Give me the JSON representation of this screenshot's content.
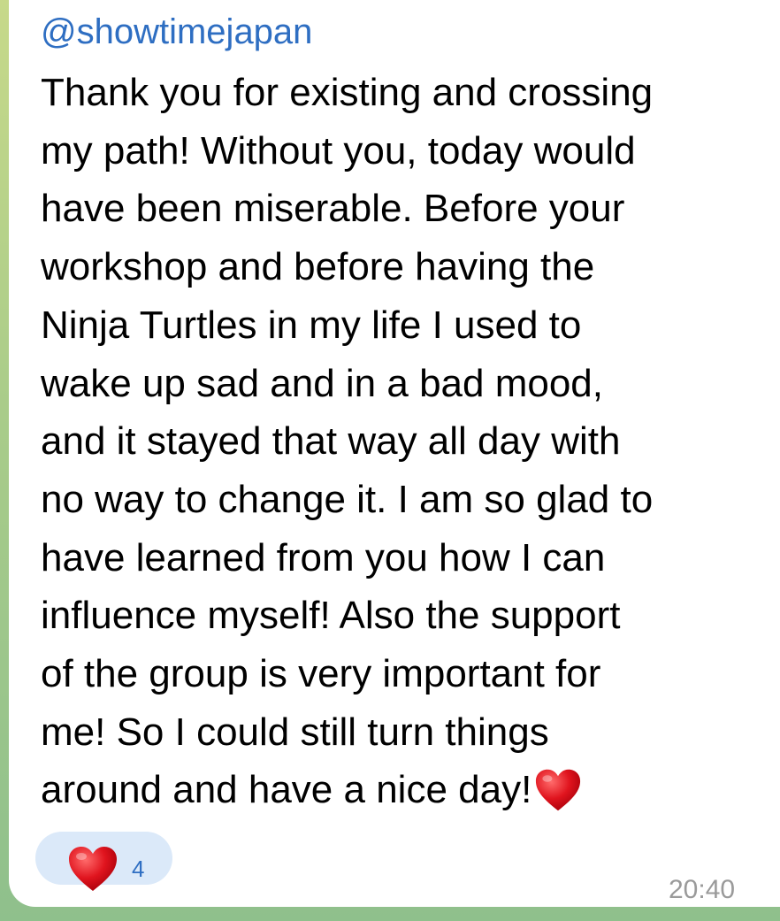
{
  "message": {
    "sender": "@showtimejapan",
    "lines": [
      "Thank you for existing and crossing",
      "my path! Without you, today would",
      "have been miserable. Before your",
      "workshop and before having the",
      "Ninja Turtles in my life I used to",
      "wake up sad and in a bad mood,",
      "and it stayed that way all day with",
      "no way to change it. I am so glad to",
      "have learned from you how I can",
      "influence myself! Also the support",
      "of the group is very important for",
      "me! So I could still turn things",
      "around and have a nice day!"
    ],
    "trailing_emoji": "heart-emoji",
    "time": "20:40"
  },
  "reaction": {
    "icon": "heart-icon",
    "count": "4"
  },
  "colors": {
    "sender": "#2e6ec2",
    "reaction_bg": "#dbe9f9",
    "heart": "#e0141e",
    "timestamp": "#9a9a9a",
    "bubble": "#ffffff"
  }
}
